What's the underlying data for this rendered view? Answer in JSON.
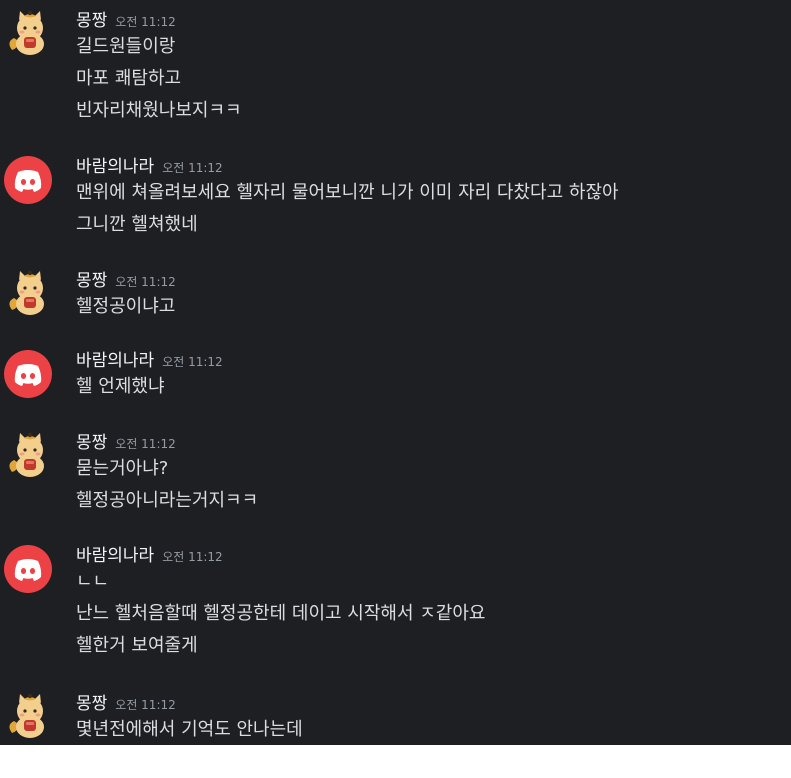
{
  "colors": {
    "background": "#1e1f22",
    "username": "#f2f3f5",
    "message_text": "#dbdee1",
    "timestamp": "#949ba4",
    "discord_avatar": "#ed4245"
  },
  "messages": [
    {
      "avatar": "cat-avatar-icon",
      "username": "몽짱",
      "time": "오전 11:12",
      "lines": [
        "길드원들이랑",
        "마포 쾌탐하고",
        "빈자리채웠나보지ㅋㅋ"
      ]
    },
    {
      "avatar": "discord-logo-icon",
      "username": "바람의나라",
      "time": "오전 11:12",
      "lines": [
        "맨위에 쳐올려보세요 헬자리 물어보니깐 니가 이미 자리 다찼다고 하잖아",
        "그니깐 헬쳐했네"
      ]
    },
    {
      "avatar": "cat-avatar-icon",
      "username": "몽짱",
      "time": "오전 11:12",
      "lines": [
        "헬정공이냐고"
      ]
    },
    {
      "avatar": "discord-logo-icon",
      "username": "바람의나라",
      "time": "오전 11:12",
      "lines": [
        "헬 언제했냐"
      ]
    },
    {
      "avatar": "cat-avatar-icon",
      "username": "몽짱",
      "time": "오전 11:12",
      "lines": [
        "묻는거아냐?",
        "헬정공아니라는거지ㅋㅋ"
      ]
    },
    {
      "avatar": "discord-logo-icon",
      "username": "바람의나라",
      "time": "오전 11:12",
      "lines": [
        "ㄴㄴ",
        "난느 헬처음할때 헬정공한테 데이고 시작해서 ㅈ같아요",
        "헬한거 보여줄게"
      ]
    },
    {
      "avatar": "cat-avatar-icon",
      "username": "몽짱",
      "time": "오전 11:12",
      "lines": [
        "몇년전에해서 기억도 안나는데"
      ]
    }
  ]
}
